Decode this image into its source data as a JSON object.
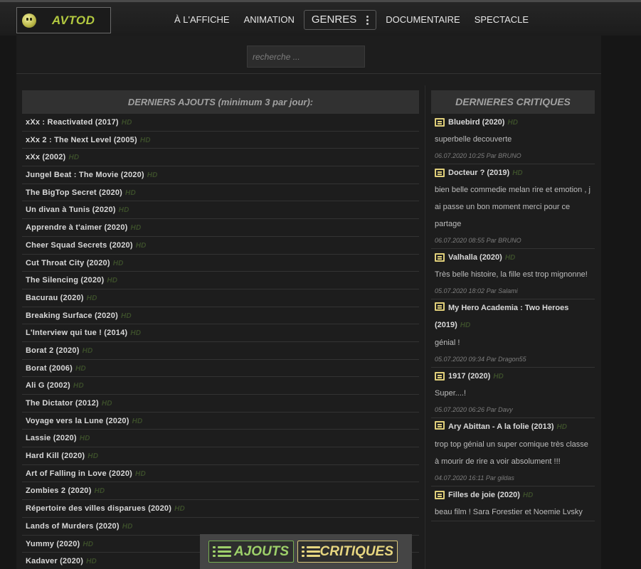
{
  "brand": {
    "name": "AVTOD"
  },
  "nav": [
    {
      "label": "À L'AFFICHE"
    },
    {
      "label": "ANIMATION"
    },
    {
      "label": "GENRES"
    },
    {
      "label": "DOCUMENTAIRE"
    },
    {
      "label": "SPECTACLE"
    }
  ],
  "search": {
    "placeholder": "recherche ..."
  },
  "latest": {
    "heading": "DERNIERS AJOUTS (minimum 3 par jour):",
    "hd_label": "HD",
    "items": [
      "xXx : Reactivated (2017)",
      "xXx 2 : The Next Level (2005)",
      "xXx (2002)",
      "Jungel Beat : The Movie (2020)",
      "The BigTop Secret (2020)",
      "Un divan à Tunis (2020)",
      "Apprendre à t'aimer (2020)",
      "Cheer Squad Secrets (2020)",
      "Cut Throat City (2020)",
      "The Silencing (2020)",
      "Bacurau (2020)",
      "Breaking Surface (2020)",
      "L'Interview qui tue ! (2014)",
      "Borat 2 (2020)",
      "Borat (2006)",
      "Ali G (2002)",
      "The Dictator (2012)",
      "Voyage vers la Lune (2020)",
      "Lassie (2020)",
      "Hard Kill (2020)",
      "Art of Falling in Love (2020)",
      "Zombies 2 (2020)",
      "Répertoire des villes disparues (2020)",
      "Lands of Murders (2020)",
      "Yummy (2020)",
      "Kadaver (2020)"
    ]
  },
  "critiques": {
    "heading": "DERNIERES CRITIQUES",
    "items": [
      {
        "title": "Bluebird (2020)",
        "text": "superbelle decouverte",
        "meta": "06.07.2020 10:25 Par BRUNO"
      },
      {
        "title": "Docteur ? (2019)",
        "text": "bien belle commedie melan rire et emotion , j ai passe un bon moment merci pour ce partage",
        "meta": "06.07.2020 08:55 Par BRUNO"
      },
      {
        "title": "Valhalla (2020)",
        "text": "Très belle histoire, la fille est trop mignonne!",
        "meta": "05.07.2020 18:02 Par Salami"
      },
      {
        "title": "My Hero Academia : Two Heroes (2019)",
        "text": "génial !",
        "meta": "05.07.2020 09:34 Par Dragon55"
      },
      {
        "title": "1917 (2020)",
        "text": "Super....!",
        "meta": "05.07.2020 06:26 Par Davy"
      },
      {
        "title": "Ary Abittan - A la folie (2013)",
        "text": "trop top génial un super comique très classe à mourir de rire a voir absolument !!!",
        "meta": "04.07.2020 16:11 Par gildas"
      },
      {
        "title": "Filles de joie (2020)",
        "text": "beau film ! Sara Forestier et Noemie Lvsky",
        "meta": ""
      }
    ]
  },
  "bottom": {
    "ajouts_label": "AJOUTS",
    "critiques_label": "CRITIQUES"
  },
  "colors": {
    "hd": "#3b4d2a",
    "ajouts": "#9dd06a",
    "critiques": "#e7d680",
    "brand": "#b3c940"
  }
}
